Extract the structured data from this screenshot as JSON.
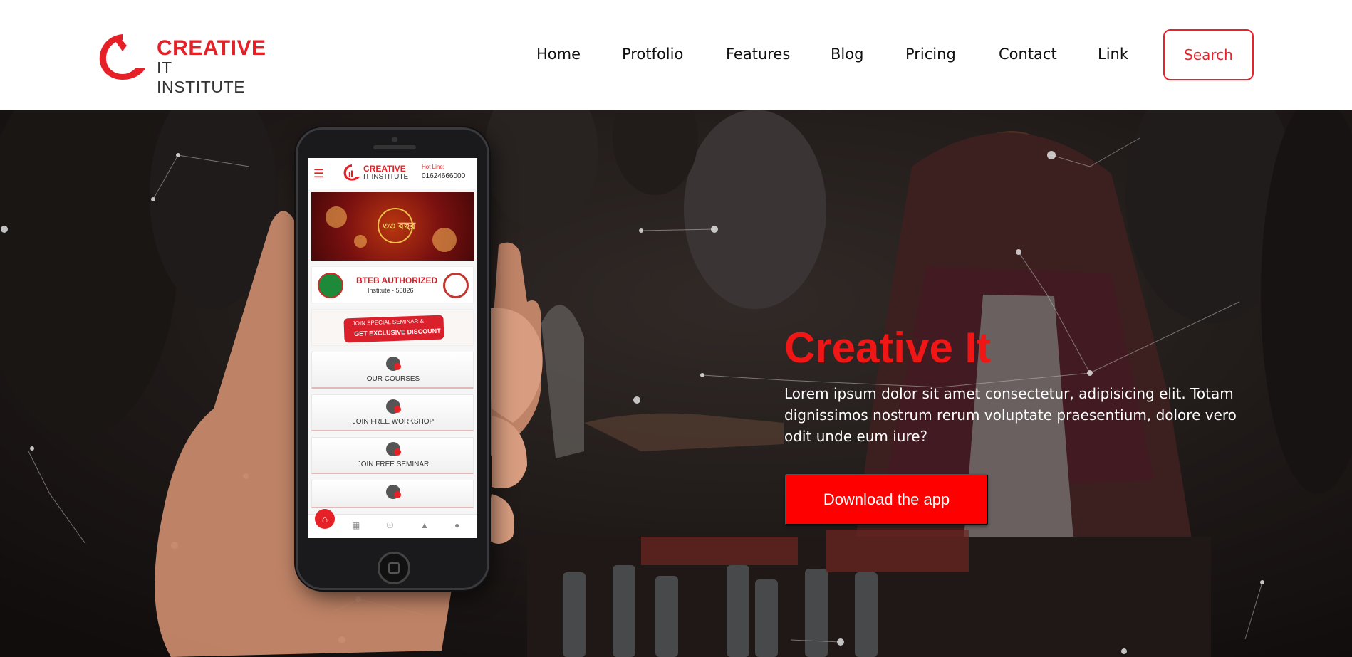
{
  "brand": {
    "name_line1": "CREATIVE",
    "name_line2": "IT INSTITUTE",
    "color": "#e52127"
  },
  "nav": {
    "items": [
      {
        "label": "Home"
      },
      {
        "label": "Protfolio"
      },
      {
        "label": "Features"
      },
      {
        "label": "Blog"
      },
      {
        "label": "Pricing"
      },
      {
        "label": "Contact"
      },
      {
        "label": "Link"
      }
    ],
    "search_label": "Search"
  },
  "hero": {
    "title": "Creative It",
    "description": "Lorem ipsum dolor sit amet consectetur, adipisicing elit. Totam dignissimos nostrum rerum voluptate praesentium, dolore vero odit unde eum iure?",
    "cta_label": "Download the app",
    "title_color": "#f01616",
    "cta_color": "#ff0000"
  },
  "app_screen": {
    "logo_line1": "CREATIVE",
    "logo_line2": "IT INSTITUTE",
    "hotline_label": "Hot Line:",
    "hotline_number": "01624666000",
    "banner_badge_text": "৩৩ বছর",
    "authorized_title": "BTEB AUTHORIZED",
    "authorized_sub": "Institute - 50826",
    "promo_line1": "JOIN SPECIAL SEMINAR &",
    "promo_line2": "GET EXCLUSIVE DISCOUNT",
    "cards": [
      {
        "label": "OUR COURSES"
      },
      {
        "label": "JOIN FREE WORKSHOP"
      },
      {
        "label": "JOIN FREE SEMINAR"
      }
    ],
    "tabs": [
      "home-icon",
      "grid-icon",
      "badge-icon",
      "seminar-icon",
      "location-icon"
    ]
  }
}
